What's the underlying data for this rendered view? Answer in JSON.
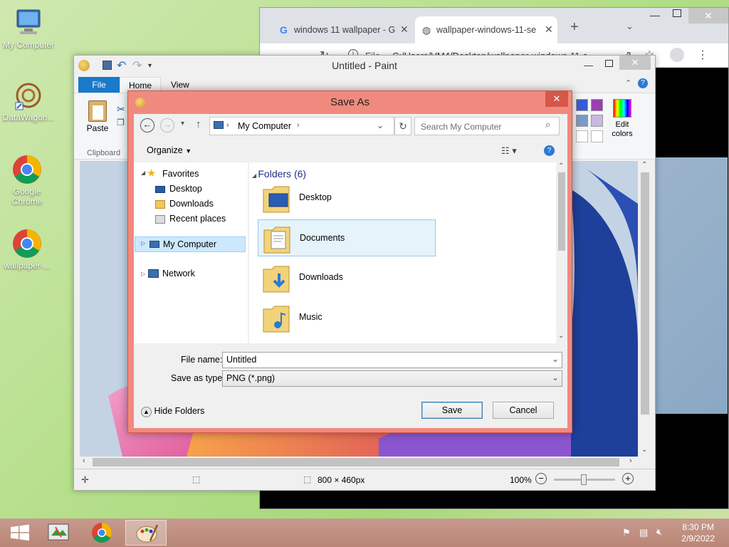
{
  "desktop": {
    "icons": [
      {
        "label": "My Computer"
      },
      {
        "label": "DataWagon..."
      },
      {
        "label": "Google Chrome"
      },
      {
        "label": "wallpaper-..."
      }
    ]
  },
  "chrome": {
    "tab1": "windows 11 wallpaper - G",
    "tab2": "wallpaper-windows-11-se",
    "scheme": "File",
    "url": "C:/Users/VM4/Desktop/wallpaper-windows-11-s..."
  },
  "paint": {
    "title": "Untitled - Paint",
    "tabs": {
      "file": "File",
      "home": "Home",
      "view": "View"
    },
    "ribbon": {
      "paste": "Paste",
      "clipboard": "Clipboard",
      "edit_colors": "Edit colors"
    },
    "status": {
      "dimensions": "800 × 460px",
      "zoom": "100%"
    }
  },
  "dialog": {
    "title": "Save As",
    "address": "My Computer",
    "search_placeholder": "Search My Computer",
    "organize": "Organize",
    "nav": {
      "favorites": "Favorites",
      "desktop": "Desktop",
      "downloads": "Downloads",
      "recent": "Recent places",
      "my_computer": "My Computer",
      "network": "Network"
    },
    "folders_header": "Folders (6)",
    "folders": [
      {
        "name": "Desktop"
      },
      {
        "name": "Documents"
      },
      {
        "name": "Downloads"
      },
      {
        "name": "Music"
      }
    ],
    "file_name_label": "File name:",
    "file_name_value": "Untitled",
    "type_label": "Save as type:",
    "type_value": "PNG (*.png)",
    "hide_folders": "Hide Folders",
    "save": "Save",
    "cancel": "Cancel"
  },
  "taskbar": {
    "time": "8:30 PM",
    "date": "2/9/2022"
  },
  "colors": {
    "dialog_frame": "#f08a7e",
    "selection": "#e5f3fb",
    "accent": "#1979ca"
  }
}
